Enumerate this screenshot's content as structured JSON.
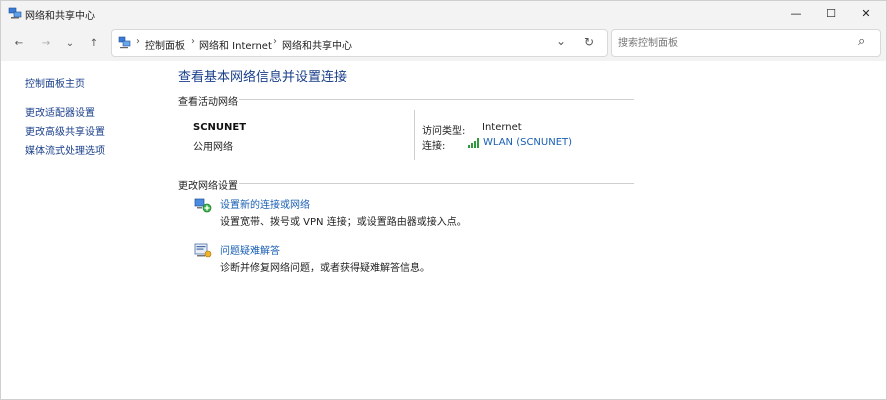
{
  "window": {
    "title": "网络和共享中心",
    "minimize_glyph": "—",
    "maximize_glyph": "☐",
    "close_glyph": "✕"
  },
  "nav": {
    "back_glyph": "←",
    "forward_glyph": "→",
    "recent_glyph": "⌄",
    "up_glyph": "↑"
  },
  "address": {
    "breadcrumbs": [
      "控制面板",
      "网络和 Internet",
      "网络和共享中心"
    ],
    "separator": "›",
    "dropdown_glyph": "⌄",
    "refresh_glyph": "↻"
  },
  "search": {
    "placeholder": "搜索控制面板",
    "search_glyph": "⌕"
  },
  "sidebar": {
    "home": "控制面板主页",
    "items": [
      "更改适配器设置",
      "更改高级共享设置",
      "媒体流式处理选项"
    ]
  },
  "main": {
    "title": "查看基本网络信息并设置连接",
    "active_networks": {
      "heading": "查看活动网络",
      "network_name": "SCNUNET",
      "network_type": "公用网络",
      "access_type_label": "访问类型:",
      "access_type_value": "Internet",
      "connection_label": "连接:",
      "connection_value": "WLAN (SCNUNET)"
    },
    "change_settings": {
      "heading": "更改网络设置",
      "tasks": [
        {
          "link": "设置新的连接或网络",
          "desc": "设置宽带、拨号或 VPN 连接；或设置路由器或接入点。",
          "icon": "network-setup-icon"
        },
        {
          "link": "问题疑难解答",
          "desc": "诊断并修复网络问题，或者获得疑难解答信息。",
          "icon": "troubleshoot-icon"
        }
      ]
    }
  },
  "colors": {
    "link": "#1a5fb4",
    "title": "#1a3f8a",
    "chrome": "#f3f3f3"
  }
}
